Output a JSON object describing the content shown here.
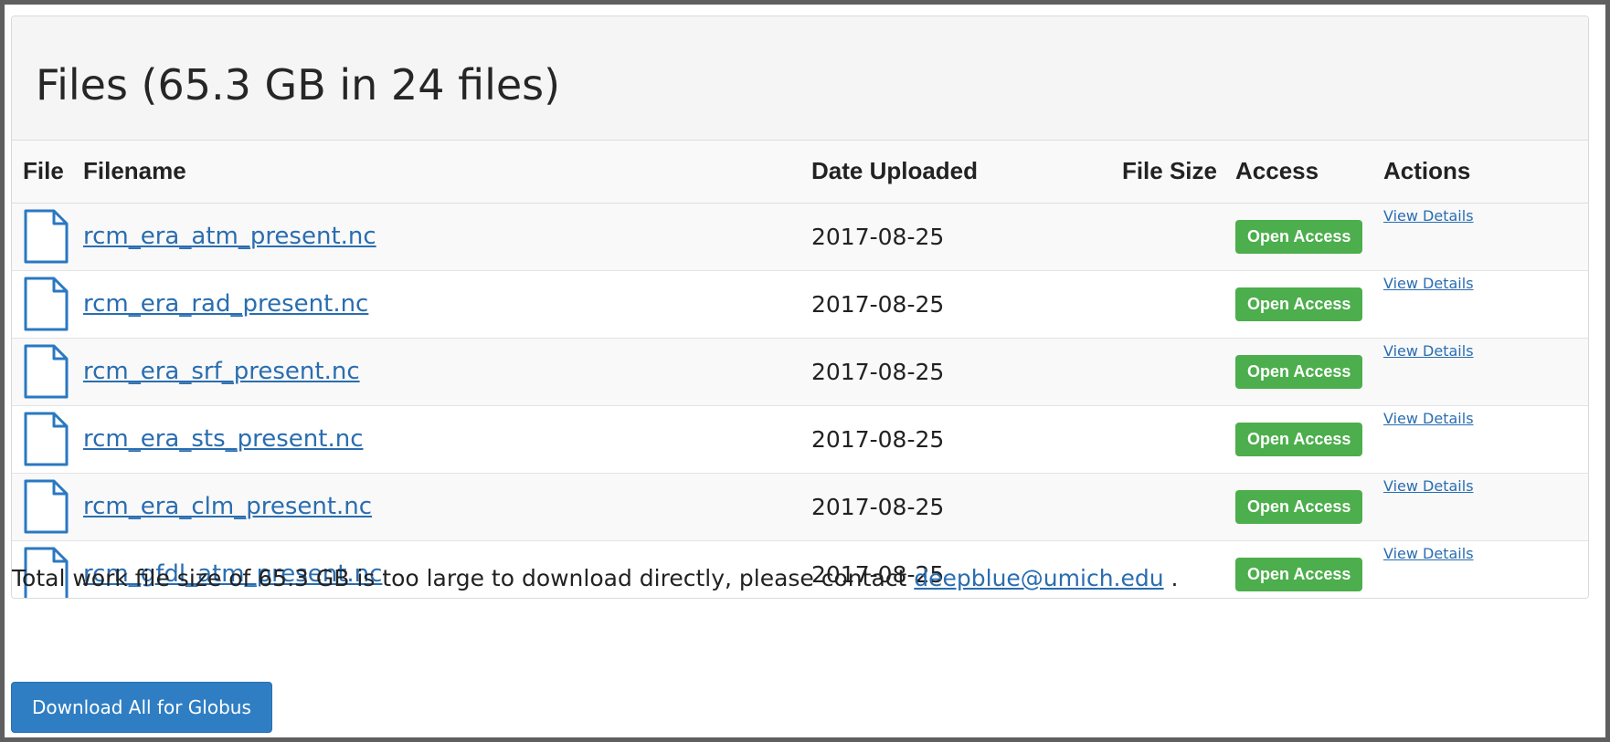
{
  "files_panel": {
    "title": "Files (65.3 GB in 24 files)",
    "columns": [
      "File",
      "Filename",
      "Date Uploaded",
      "File Size",
      "Access",
      "Actions"
    ],
    "rows": [
      {
        "icon": "document-icon",
        "filename": "rcm_era_atm_present.nc",
        "date_uploaded": "2017-08-25",
        "file_size": "",
        "access": "Open Access",
        "action": "View Details"
      },
      {
        "icon": "document-icon",
        "filename": "rcm_era_rad_present.nc",
        "date_uploaded": "2017-08-25",
        "file_size": "",
        "access": "Open Access",
        "action": "View Details"
      },
      {
        "icon": "document-icon",
        "filename": "rcm_era_srf_present.nc",
        "date_uploaded": "2017-08-25",
        "file_size": "",
        "access": "Open Access",
        "action": "View Details"
      },
      {
        "icon": "document-icon",
        "filename": "rcm_era_sts_present.nc",
        "date_uploaded": "2017-08-25",
        "file_size": "",
        "access": "Open Access",
        "action": "View Details"
      },
      {
        "icon": "document-icon",
        "filename": "rcm_era_clm_present.nc",
        "date_uploaded": "2017-08-25",
        "file_size": "",
        "access": "Open Access",
        "action": "View Details"
      },
      {
        "icon": "document-icon",
        "filename": "rcm_gfdl_atm_present.nc",
        "date_uploaded": "2017-08-25",
        "file_size": "",
        "access": "Open Access",
        "action": "View Details"
      }
    ]
  },
  "notice": {
    "text_before": "Total work file size of 65.3 GB is too large to download directly, please contact ",
    "email": "deepblue@umich.edu",
    "text_after": " ."
  },
  "download_button": {
    "label": "Download All for Globus"
  },
  "colors": {
    "link": "#2a6db0",
    "badge_green": "#4cae4c",
    "button_blue": "#2f7ec3",
    "frame_border": "#5f5f5f"
  }
}
